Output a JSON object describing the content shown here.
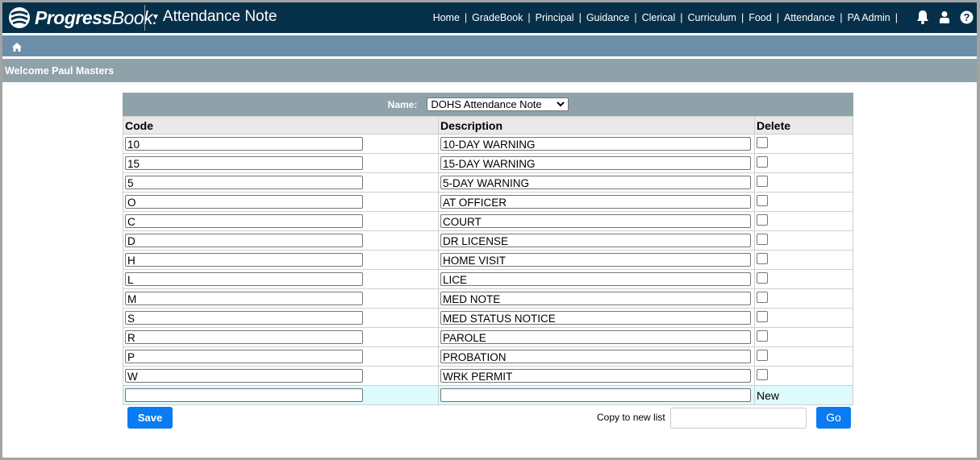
{
  "header": {
    "logo_text_bold": "Progress",
    "logo_text_regular": "Book.",
    "app_title": "Attendance Note",
    "nav": [
      "Home",
      "GradeBook",
      "Principal",
      "Guidance",
      "Clerical",
      "Curriculum",
      "Food",
      "Attendance",
      "PA Admin"
    ],
    "icons": [
      "bell-icon",
      "user-icon",
      "help-icon"
    ]
  },
  "breadcrumb": {
    "icon": "home-icon"
  },
  "welcome": "Welcome Paul Masters",
  "name_select": {
    "label": "Name:",
    "value": "DOHS Attendance Note"
  },
  "table": {
    "columns": [
      "Code",
      "Description",
      "Delete"
    ],
    "rows": [
      {
        "code": "10",
        "description": "10-DAY WARNING",
        "delete": false
      },
      {
        "code": "15",
        "description": "15-DAY WARNING",
        "delete": false
      },
      {
        "code": "5",
        "description": "5-DAY WARNING",
        "delete": false
      },
      {
        "code": "O",
        "description": "AT OFFICER",
        "delete": false
      },
      {
        "code": "C",
        "description": "COURT",
        "delete": false
      },
      {
        "code": "D",
        "description": "DR LICENSE",
        "delete": false
      },
      {
        "code": "H",
        "description": "HOME VISIT",
        "delete": false
      },
      {
        "code": "L",
        "description": "LICE",
        "delete": false
      },
      {
        "code": "M",
        "description": "MED NOTE",
        "delete": false
      },
      {
        "code": "S",
        "description": "MED STATUS NOTICE",
        "delete": false
      },
      {
        "code": "R",
        "description": "PAROLE",
        "delete": false
      },
      {
        "code": "P",
        "description": "PROBATION",
        "delete": false
      },
      {
        "code": "W",
        "description": "WRK PERMIT",
        "delete": false
      }
    ],
    "new_row": {
      "code": "",
      "description": "",
      "label": "New"
    }
  },
  "actions": {
    "save_label": "Save",
    "copy_label": "Copy to new list",
    "copy_value": "",
    "go_label": "Go"
  }
}
